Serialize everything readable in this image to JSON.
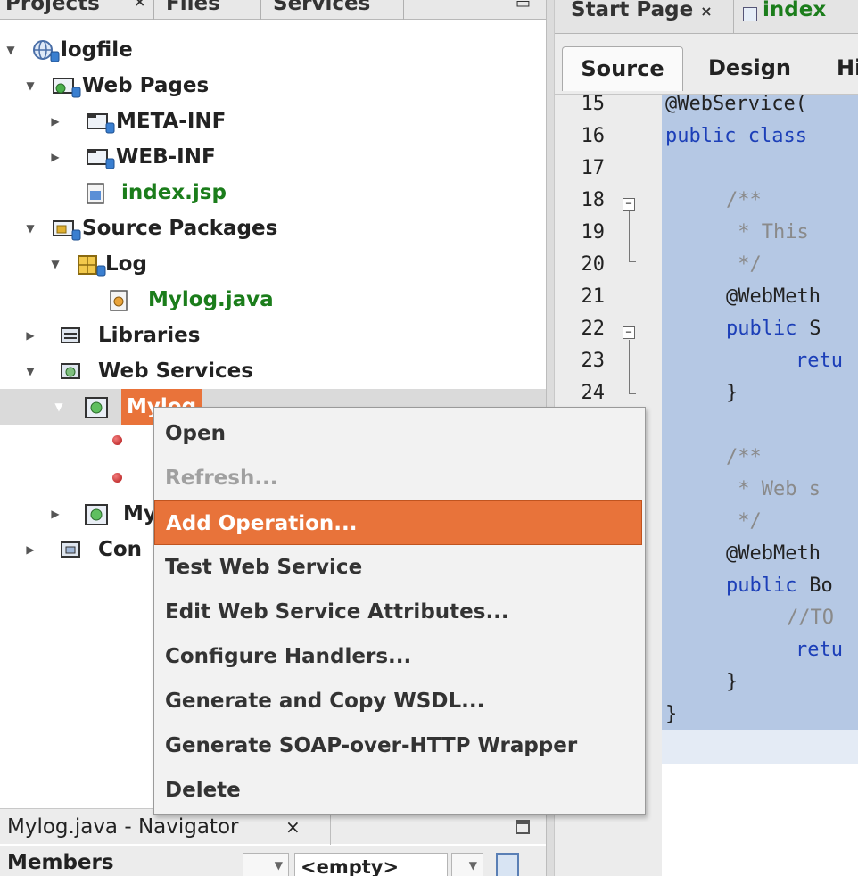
{
  "projects_tabs": {
    "projects": "Projects",
    "files": "Files",
    "services": "Services"
  },
  "tree": {
    "project": "logfile",
    "web_pages": "Web Pages",
    "meta_inf": "META-INF",
    "web_inf": "WEB-INF",
    "index_jsp": "index.jsp",
    "source_packages": "Source Packages",
    "package_log": "Log",
    "mylog_java": "Mylog.java",
    "libraries": "Libraries",
    "web_services": "Web Services",
    "service_mylog": "Mylog",
    "second_service_partial": "My",
    "conf_partial": "Con"
  },
  "context_menu": {
    "items": [
      {
        "label": "Open",
        "enabled": true
      },
      {
        "label": "Refresh...",
        "enabled": false
      },
      {
        "label": "Add Operation...",
        "enabled": true,
        "highlighted": true
      },
      {
        "label": "Test Web Service",
        "enabled": true
      },
      {
        "label": "Edit Web Service Attributes...",
        "enabled": true
      },
      {
        "label": "Configure Handlers...",
        "enabled": true
      },
      {
        "label": "Generate and Copy WSDL...",
        "enabled": true
      },
      {
        "label": "Generate SOAP-over-HTTP Wrapper",
        "enabled": true
      },
      {
        "label": "Delete",
        "enabled": true
      }
    ]
  },
  "navigator": {
    "title": "Mylog.java - Navigator",
    "close": "×",
    "members_label": "Members",
    "filter_value": "<empty>"
  },
  "editor": {
    "tab_start": "Start Page",
    "tab_start_close": "×",
    "tab_index": "index",
    "source_button": "Source",
    "design_button": "Design",
    "history_button": "Hi",
    "line_numbers": [
      "15",
      "16",
      "17",
      "18",
      "19",
      "20",
      "21",
      "22",
      "23",
      "24"
    ],
    "code": {
      "l15": "@WebService(",
      "l16_kw": "public class",
      "l18": "/**",
      "l19": " * This",
      "l20": " */",
      "l21": "@WebMeth",
      "l22_kw": "public",
      "l22_rest": " S",
      "l23": "retu",
      "l24": "}",
      "l26": "/**",
      "l27": " * Web s",
      "l28": " */",
      "l29": "@WebMeth",
      "l30_kw": "public",
      "l30_rest": " Bo",
      "l31": "//TO",
      "l32": "retu",
      "l33": "}",
      "l34": "}"
    }
  },
  "colors": {
    "highlight": "#e8733a",
    "selection": "#b5c8e4",
    "keyword": "#1c3fb8",
    "green_file": "#1b7d1b"
  }
}
